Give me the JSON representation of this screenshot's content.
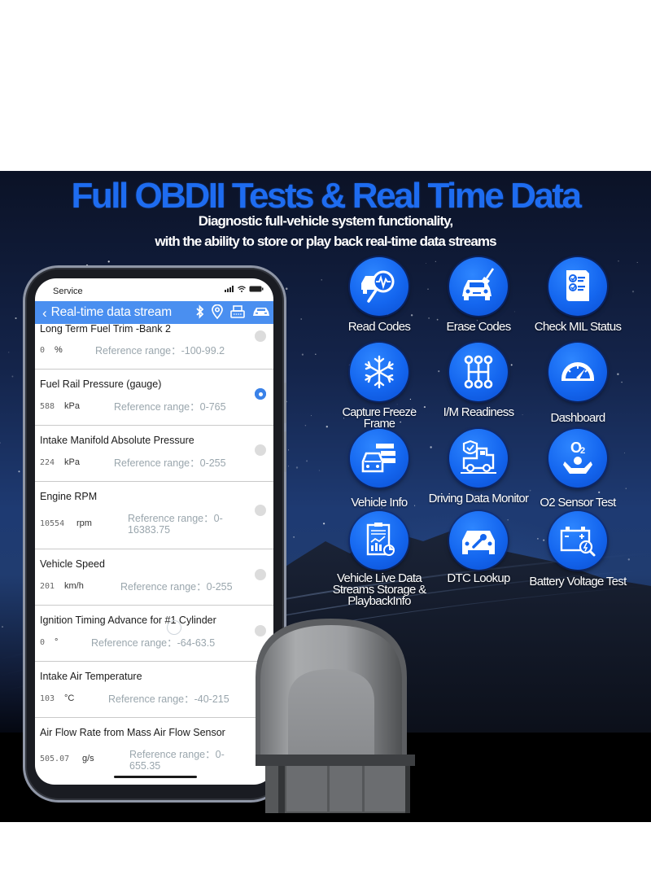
{
  "banner": {
    "headline": "Full OBDII Tests & Real Time Data",
    "subline_1": "Diagnostic full-vehicle system functionality,",
    "subline_2": "with the ability to store or play back real-time data streams"
  },
  "phone": {
    "status_bar": {
      "carrier": "Service",
      "icons": [
        "signal-icon",
        "wifi-icon",
        "battery-icon"
      ]
    },
    "nav": {
      "back_icon": "chevron-left-icon",
      "title": "Real-time data stream",
      "icons": [
        "bluetooth-icon",
        "location-pin-icon",
        "obd-connector-icon",
        "car-icon"
      ]
    },
    "accent_color": "#4a8ff0",
    "data_stream": [
      {
        "name": "Long Term Fuel Trim -Bank 2",
        "value": "0",
        "unit": "%",
        "reference": "Reference range：-100-99.2",
        "selected": false
      },
      {
        "name": "Fuel Rail Pressure (gauge)",
        "value": "588",
        "unit": "kPa",
        "reference": "Reference range：0-765",
        "selected": true
      },
      {
        "name": "Intake Manifold Absolute Pressure",
        "value": "224",
        "unit": "kPa",
        "reference": "Reference range：0-255",
        "selected": false
      },
      {
        "name": "Engine RPM",
        "value": "10554",
        "unit": "rpm",
        "reference": "Reference range：0-16383.75",
        "selected": false
      },
      {
        "name": "Vehicle Speed",
        "value": "201",
        "unit": "km/h",
        "reference": "Reference range：0-255",
        "selected": false
      },
      {
        "name": "Ignition Timing Advance for #1 Cylinder",
        "value": "0",
        "unit": "°",
        "reference": "Reference range：-64-63.5",
        "selected": false
      },
      {
        "name": "Intake Air Temperature",
        "value": "103",
        "unit": "°C",
        "reference": "Reference range：-40-215",
        "selected": false
      },
      {
        "name": "Air Flow Rate from Mass Air Flow Sensor",
        "value": "505.07",
        "unit": "g/s",
        "reference": "Reference range：0-655.35",
        "selected": false
      }
    ]
  },
  "features": [
    {
      "label": "Read Codes",
      "icon": "car-diagnostic-magnifier-icon"
    },
    {
      "label": "Erase Codes",
      "icon": "car-broom-icon"
    },
    {
      "label": "Check MIL Status",
      "icon": "checklist-icon"
    },
    {
      "label": "Capture Freeze Frame",
      "icon": "snowflake-icon"
    },
    {
      "label": "I/M Readiness",
      "icon": "gear-shift-icon"
    },
    {
      "label": "Dashboard",
      "icon": "speedometer-icon"
    },
    {
      "label": "Vehicle Info",
      "icon": "car-info-icon"
    },
    {
      "label": "Driving Data Monitor",
      "icon": "truck-shield-icon"
    },
    {
      "label": "O2 Sensor Test",
      "icon": "o2-sensor-icon"
    },
    {
      "label": "Vehicle Live Data Streams Storage & PlaybackInfo",
      "icon": "clipboard-chart-icon"
    },
    {
      "label": "DTC Lookup",
      "icon": "car-wrench-icon"
    },
    {
      "label": "Battery Voltage Test",
      "icon": "battery-search-icon"
    }
  ],
  "colors": {
    "headline": "#1e6cf0",
    "feature_circle": "#1466ef",
    "radio_selected": "#3a82e8",
    "radio_unselected": "#dcdcdc"
  }
}
